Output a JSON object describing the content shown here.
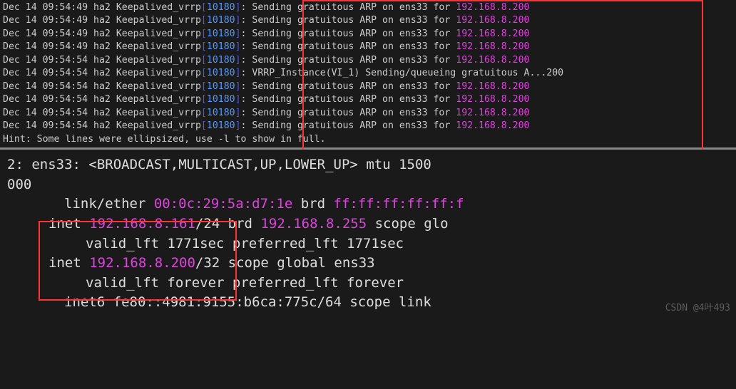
{
  "top": {
    "lines": [
      {
        "ts": "Dec 14 09:54:49",
        "host": "ha2",
        "process": "Keepalived_vrrp",
        "pid": "10180",
        "msg_prefix": "Sending gratuitous ARP on ens33 for ",
        "ip": "192.168.8.200",
        "msg_suffix": ""
      },
      {
        "ts": "Dec 14 09:54:49",
        "host": "ha2",
        "process": "Keepalived_vrrp",
        "pid": "10180",
        "msg_prefix": "Sending gratuitous ARP on ens33 for ",
        "ip": "192.168.8.200",
        "msg_suffix": ""
      },
      {
        "ts": "Dec 14 09:54:49",
        "host": "ha2",
        "process": "Keepalived_vrrp",
        "pid": "10180",
        "msg_prefix": "Sending gratuitous ARP on ens33 for ",
        "ip": "192.168.8.200",
        "msg_suffix": ""
      },
      {
        "ts": "Dec 14 09:54:49",
        "host": "ha2",
        "process": "Keepalived_vrrp",
        "pid": "10180",
        "msg_prefix": "Sending gratuitous ARP on ens33 for ",
        "ip": "192.168.8.200",
        "msg_suffix": ""
      },
      {
        "ts": "Dec 14 09:54:54",
        "host": "ha2",
        "process": "Keepalived_vrrp",
        "pid": "10180",
        "msg_prefix": "Sending gratuitous ARP on ens33 for ",
        "ip": "192.168.8.200",
        "msg_suffix": ""
      },
      {
        "ts": "Dec 14 09:54:54",
        "host": "ha2",
        "process": "Keepalived_vrrp",
        "pid": "10180",
        "msg_prefix": "VRRP_Instance(VI_1) Sending/queueing gratuitous A...200",
        "ip": "",
        "msg_suffix": ""
      },
      {
        "ts": "Dec 14 09:54:54",
        "host": "ha2",
        "process": "Keepalived_vrrp",
        "pid": "10180",
        "msg_prefix": "Sending gratuitous ARP on ens33 for ",
        "ip": "192.168.8.200",
        "msg_suffix": ""
      },
      {
        "ts": "Dec 14 09:54:54",
        "host": "ha2",
        "process": "Keepalived_vrrp",
        "pid": "10180",
        "msg_prefix": "Sending gratuitous ARP on ens33 for ",
        "ip": "192.168.8.200",
        "msg_suffix": ""
      },
      {
        "ts": "Dec 14 09:54:54",
        "host": "ha2",
        "process": "Keepalived_vrrp",
        "pid": "10180",
        "msg_prefix": "Sending gratuitous ARP on ens33 for ",
        "ip": "192.168.8.200",
        "msg_suffix": ""
      },
      {
        "ts": "Dec 14 09:54:54",
        "host": "ha2",
        "process": "Keepalived_vrrp",
        "pid": "10180",
        "msg_prefix": "Sending gratuitous ARP on ens33 for ",
        "ip": "192.168.8.200",
        "msg_suffix": ""
      }
    ],
    "hint": "Hint: Some lines were ellipsized, use -l to show in full."
  },
  "bottom": {
    "iface_line1": "2: ens33: <BROADCAST,MULTICAST,UP,LOWER_UP> mtu 1500",
    "iface_line2": "000",
    "link_prefix": "link/ether ",
    "mac": "00:0c:29:5a:d7:1e",
    "link_brd": " brd ",
    "mac_brd": "ff:ff:ff:ff:ff:f",
    "inet1_prefix": "inet ",
    "inet1_ip": "192.168.8.161",
    "inet1_cidr": "/24 brd ",
    "inet1_bcast": "192.168.8.255",
    "inet1_suffix": " scope glo",
    "valid1": "valid_lft 1771sec preferred_lft 1771sec",
    "inet2_prefix": "inet ",
    "inet2_ip": "192.168.8.200",
    "inet2_suffix": "/32 scope global ens33",
    "valid2": "valid_lft forever preferred_lft forever",
    "inet6": "inet6 fe80::4981:9155:b6ca:775c/64 scope link"
  },
  "watermark": "CSDN @4叶493"
}
